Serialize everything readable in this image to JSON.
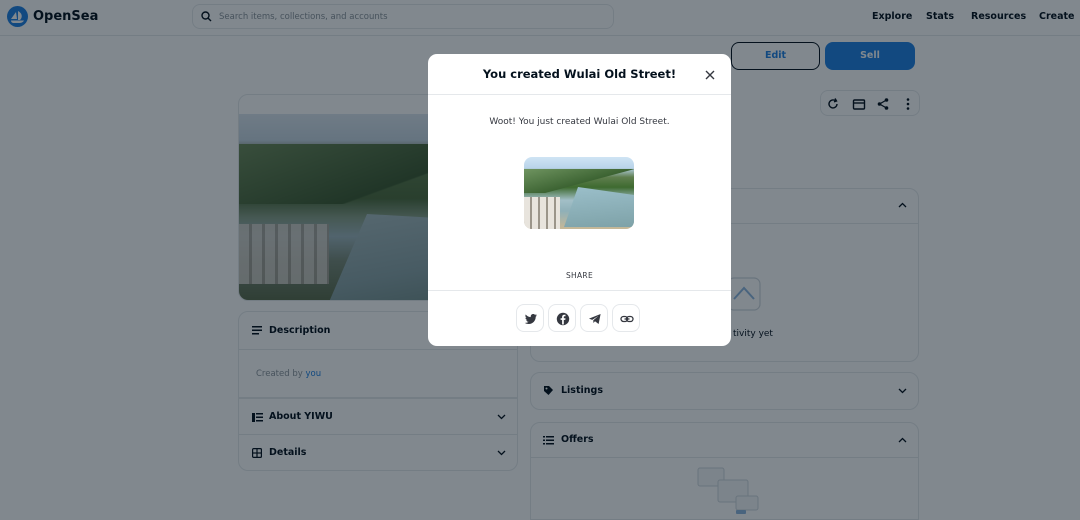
{
  "nav": {
    "brand": "OpenSea",
    "search_placeholder": "Search items, collections, and accounts",
    "links": [
      "Explore",
      "Stats",
      "Resources",
      "Create"
    ]
  },
  "actions": {
    "edit_label": "Edit",
    "sell_label": "Sell"
  },
  "left": {
    "description_title": "Description",
    "created_by_prefix": "Created by",
    "created_by_link": "you",
    "about_title": "About YIWU",
    "details_title": "Details"
  },
  "right": {
    "no_activity": "tivity yet",
    "listings_title": "Listings",
    "offers_title": "Offers"
  },
  "modal": {
    "title": "You created Wulai Old Street!",
    "message": "Woot! You just created Wulai Old Street.",
    "share_label": "SHARE"
  },
  "colors": {
    "brand_blue": "#2081e2",
    "text_dark": "#04111d",
    "muted": "#8a939b",
    "border": "#e5e8eb"
  }
}
